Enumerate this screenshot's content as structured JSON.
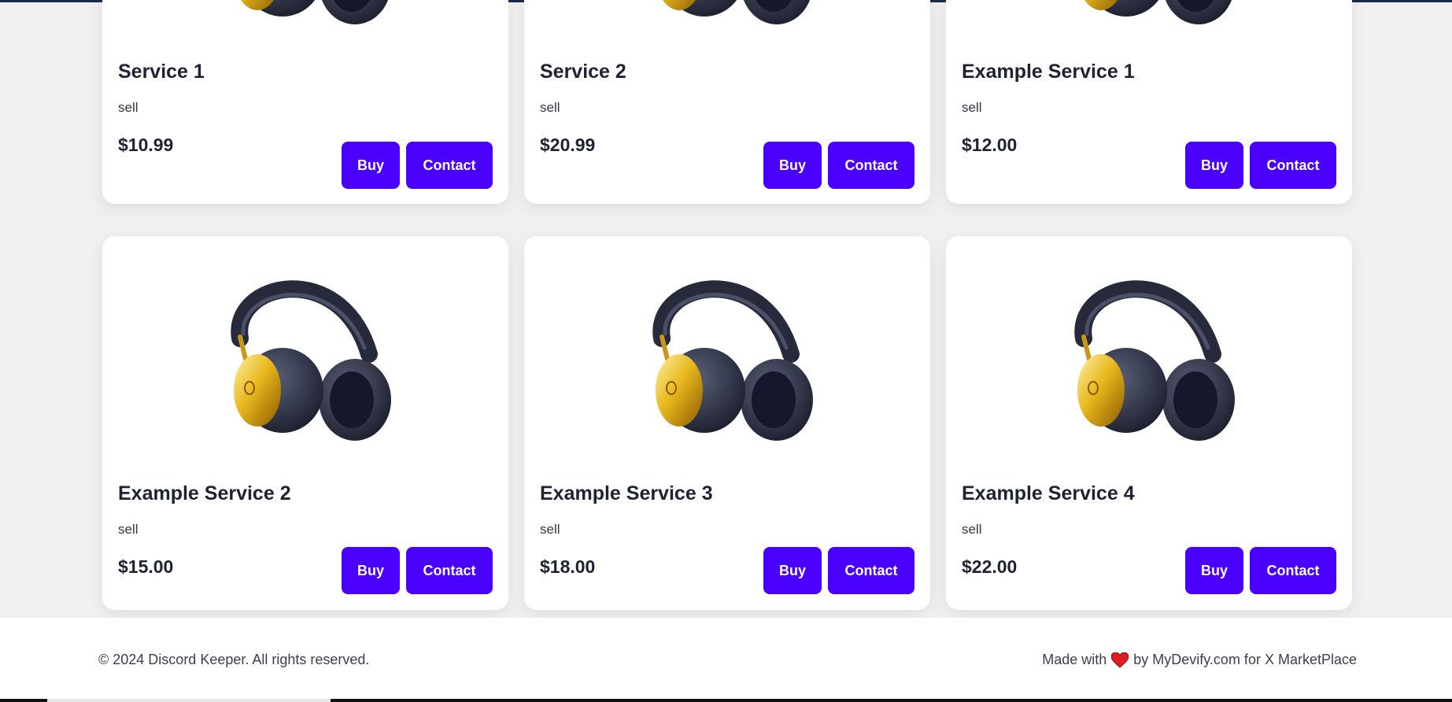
{
  "services": [
    {
      "title": "Service 1",
      "description": "sell",
      "price": "$10.99",
      "buy_label": "Buy",
      "contact_label": "Contact"
    },
    {
      "title": "Service 2",
      "description": "sell",
      "price": "$20.99",
      "buy_label": "Buy",
      "contact_label": "Contact"
    },
    {
      "title": "Example Service 1",
      "description": "sell",
      "price": "$12.00",
      "buy_label": "Buy",
      "contact_label": "Contact"
    },
    {
      "title": "Example Service 2",
      "description": "sell",
      "price": "$15.00",
      "buy_label": "Buy",
      "contact_label": "Contact"
    },
    {
      "title": "Example Service 3",
      "description": "sell",
      "price": "$18.00",
      "buy_label": "Buy",
      "contact_label": "Contact"
    },
    {
      "title": "Example Service 4",
      "description": "sell",
      "price": "$22.00",
      "buy_label": "Buy",
      "contact_label": "Contact"
    }
  ],
  "product_icon": "headphones-icon",
  "footer": {
    "copyright": "© 2024 Discord Keeper. All rights reserved.",
    "made_with": "Made with",
    "heart_icon": "heart-icon",
    "by_text": "by MyDevify.com for X MarketPlace"
  },
  "colors": {
    "button": "#4a00ff",
    "heart": "#e01b24",
    "background": "#f0f0f0"
  }
}
